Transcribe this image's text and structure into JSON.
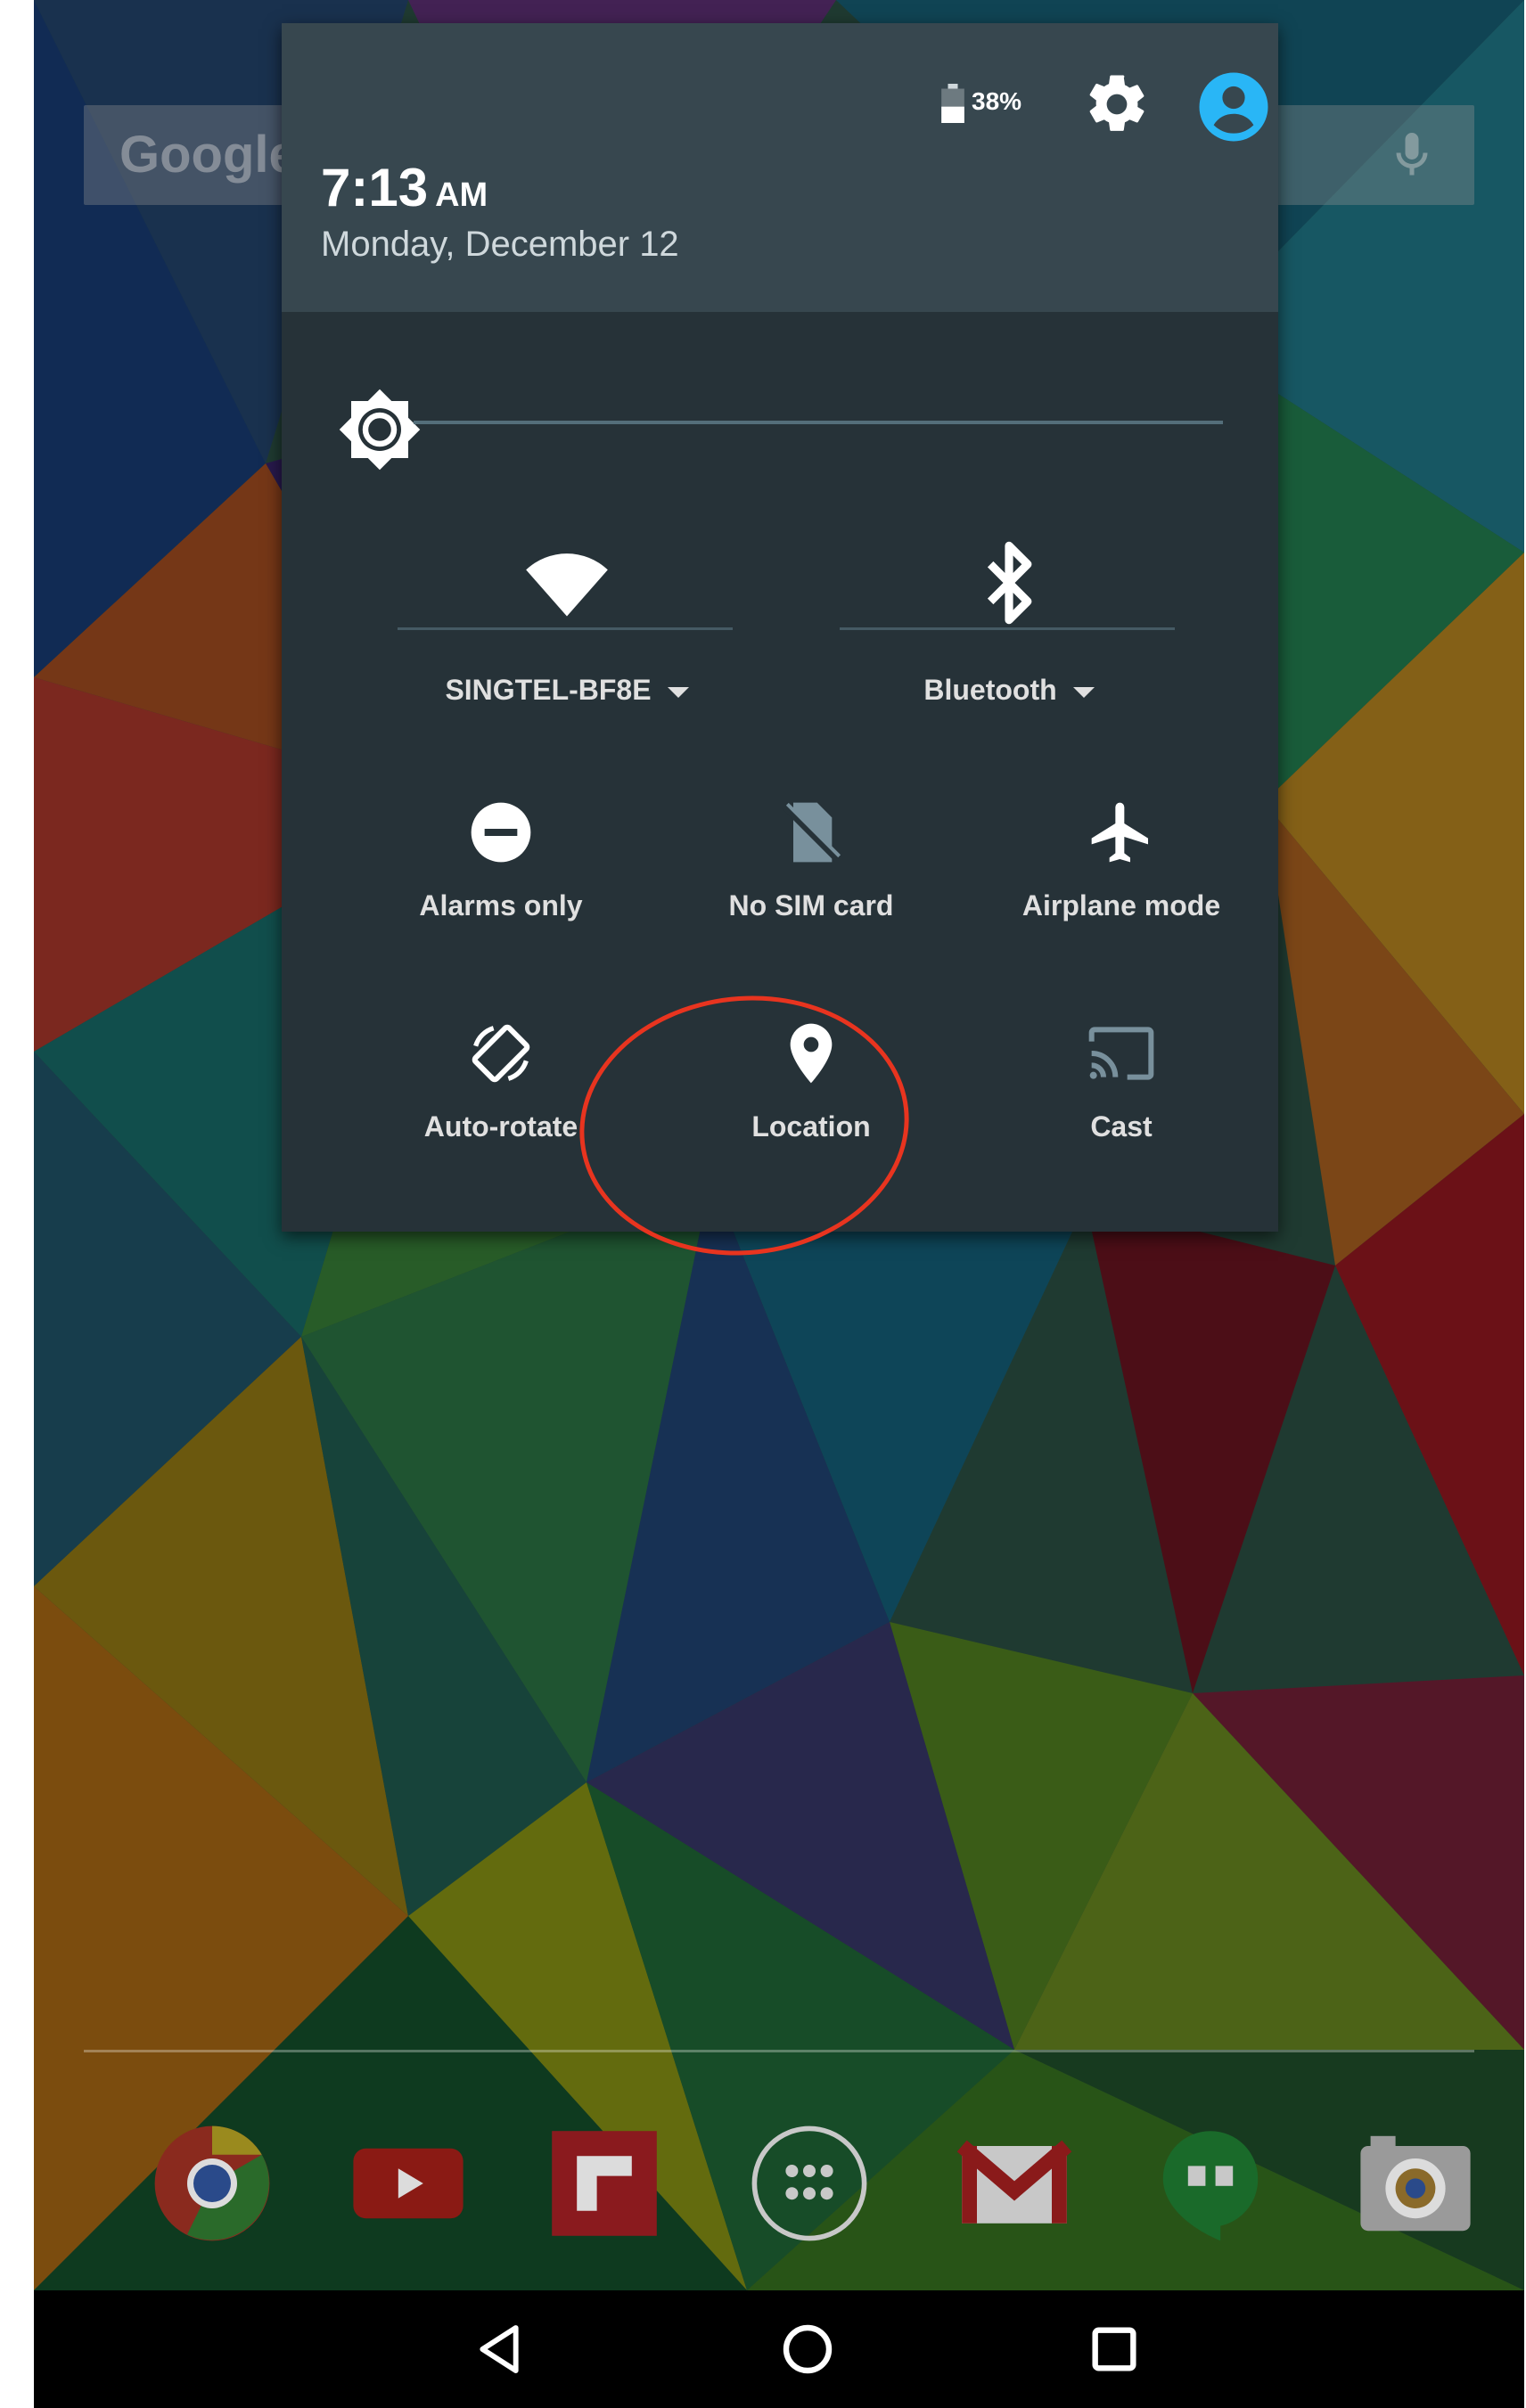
{
  "status": {
    "time": "7:13",
    "ampm": "AM",
    "date": "Monday, December 12",
    "battery": "38%"
  },
  "search": {
    "logo_text": "Google"
  },
  "quick_settings": {
    "wifi_label": "SINGTEL-BF8E",
    "bluetooth_label": "Bluetooth",
    "tiles": [
      {
        "label": "Alarms only",
        "icon": "do-not-disturb-icon"
      },
      {
        "label": "No SIM card",
        "icon": "no-sim-icon"
      },
      {
        "label": "Airplane mode",
        "icon": "airplane-icon"
      },
      {
        "label": "Auto-rotate",
        "icon": "auto-rotate-icon"
      },
      {
        "label": "Location",
        "icon": "location-pin-icon"
      },
      {
        "label": "Cast",
        "icon": "cast-icon"
      }
    ]
  },
  "dock": {
    "apps": [
      "chrome-icon",
      "youtube-icon",
      "flipboard-icon",
      "app-drawer-icon",
      "gmail-icon",
      "hangouts-icon",
      "camera-icon"
    ]
  },
  "colors": {
    "panel_background": "#263238",
    "panel_header": "#37474f",
    "accent": "#29b6f6",
    "highlight_circle": "#e8341f"
  }
}
